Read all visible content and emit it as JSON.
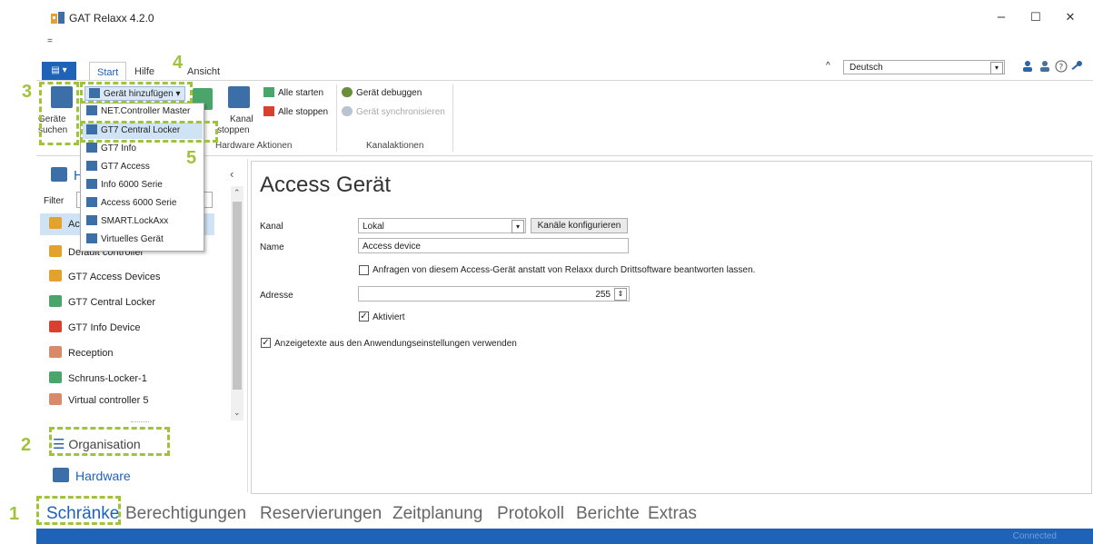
{
  "window": {
    "title": "GAT Relaxx 4.2.0",
    "qat_glyph": "=",
    "minimize": "–",
    "maximize": "☐",
    "close": "✕"
  },
  "ribbon_tabs": {
    "app_menu": "▤ ▾",
    "start": "Start",
    "hilfe": "Hilfe",
    "ansicht": "Ansicht"
  },
  "language": {
    "value": "Deutsch",
    "caret": "^"
  },
  "ribbon": {
    "geraete_suchen": [
      "Geräte",
      "suchen"
    ],
    "geraet_hinzufuegen": "Gerät hinzufügen",
    "kanal_stoppen": [
      "Kanal",
      "stoppen"
    ],
    "alle_starten": "Alle starten",
    "alle_stoppen": "Alle stoppen",
    "geraet_debuggen": "Gerät debuggen",
    "geraet_synchronisieren": "Gerät synchronisieren",
    "group_hardware": "Hardware Aktionen",
    "group_kanal": "Kanalaktionen"
  },
  "dropdown": {
    "items": [
      "NET.Controller Master",
      "GT7 Central Locker",
      "GT7 Info",
      "GT7 Access",
      "Info 6000 Serie",
      "Access 6000 Serie",
      "SMART.LockAxx",
      "Virtuelles Gerät"
    ]
  },
  "left_panel": {
    "header_partial": "H",
    "filter_label": "Filter",
    "collapse": "‹",
    "selected_partial": "Ac",
    "controllers": [
      "Default controller",
      "GT7 Access Devices",
      "GT7 Central Locker",
      "GT7 Info Device",
      "Reception",
      "Schruns-Locker-1",
      "Virtual controller 5"
    ],
    "organisation": "Organisation",
    "hardware": "Hardware"
  },
  "content": {
    "title": "Access Gerät",
    "kanal_label": "Kanal",
    "kanal_value": "Lokal",
    "kanaele_button": "Kanäle konfigurieren",
    "name_label": "Name",
    "name_value": "Access device",
    "anfragen_text": "Anfragen von diesem Access-Gerät anstatt von Relaxx durch Drittsoftware beantworten lassen.",
    "adresse_label": "Adresse",
    "adresse_value": "255",
    "aktiviert_label": "Aktiviert",
    "anzeige_text": "Anzeigetexte aus den Anwendungseinstellungen verwenden"
  },
  "bottom_nav": [
    "Schränke",
    "Berechtigungen",
    "Reservierungen",
    "Zeitplanung",
    "Protokoll",
    "Berichte",
    "Extras"
  ],
  "status": {
    "connected": "Connected"
  },
  "annotations": [
    "1",
    "2",
    "3",
    "4",
    "5"
  ],
  "colors": {
    "accent": "#1e63b8",
    "annotation": "#9fc43a",
    "selection": "#cfe3f5"
  }
}
